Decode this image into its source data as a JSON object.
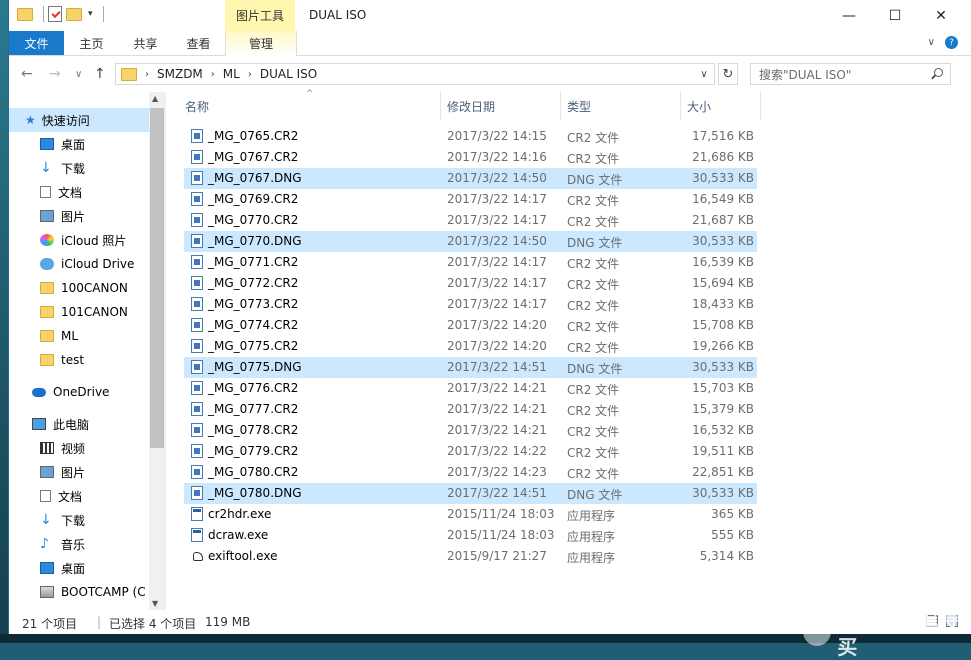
{
  "window": {
    "title": "DUAL ISO",
    "context_tab_header": "图片工具",
    "minimize": "—",
    "maximize": "☐",
    "close": "✕"
  },
  "ribbon": {
    "tabs": [
      "文件",
      "主页",
      "共享",
      "查看",
      "管理"
    ],
    "file_color": "#1979ca"
  },
  "address": {
    "crumbs": [
      "SMZDM",
      "ML",
      "DUAL ISO"
    ],
    "search_placeholder": "搜索\"DUAL ISO\""
  },
  "nav": {
    "quick_access": "快速访问",
    "items": [
      "桌面",
      "下载",
      "文档",
      "图片",
      "iCloud 照片",
      "iCloud Drive",
      "100CANON",
      "101CANON",
      "ML",
      "test"
    ],
    "onedrive": "OneDrive",
    "this_pc": "此电脑",
    "pc_items": [
      "视频",
      "图片",
      "文档",
      "下载",
      "音乐",
      "桌面",
      "BOOTCAMP (C"
    ]
  },
  "columns": {
    "name": "名称",
    "date": "修改日期",
    "type": "类型",
    "size": "大小"
  },
  "files": [
    {
      "name": "_MG_0765.CR2",
      "date": "2017/3/22 14:15",
      "type": "CR2 文件",
      "size": "17,516 KB",
      "selected": false,
      "icon": "image-file-icon"
    },
    {
      "name": "_MG_0767.CR2",
      "date": "2017/3/22 14:16",
      "type": "CR2 文件",
      "size": "21,686 KB",
      "selected": false,
      "icon": "image-file-icon"
    },
    {
      "name": "_MG_0767.DNG",
      "date": "2017/3/22 14:50",
      "type": "DNG 文件",
      "size": "30,533 KB",
      "selected": true,
      "icon": "image-file-icon"
    },
    {
      "name": "_MG_0769.CR2",
      "date": "2017/3/22 14:17",
      "type": "CR2 文件",
      "size": "16,549 KB",
      "selected": false,
      "icon": "image-file-icon"
    },
    {
      "name": "_MG_0770.CR2",
      "date": "2017/3/22 14:17",
      "type": "CR2 文件",
      "size": "21,687 KB",
      "selected": false,
      "icon": "image-file-icon"
    },
    {
      "name": "_MG_0770.DNG",
      "date": "2017/3/22 14:50",
      "type": "DNG 文件",
      "size": "30,533 KB",
      "selected": true,
      "icon": "image-file-icon"
    },
    {
      "name": "_MG_0771.CR2",
      "date": "2017/3/22 14:17",
      "type": "CR2 文件",
      "size": "16,539 KB",
      "selected": false,
      "icon": "image-file-icon"
    },
    {
      "name": "_MG_0772.CR2",
      "date": "2017/3/22 14:17",
      "type": "CR2 文件",
      "size": "15,694 KB",
      "selected": false,
      "icon": "image-file-icon"
    },
    {
      "name": "_MG_0773.CR2",
      "date": "2017/3/22 14:17",
      "type": "CR2 文件",
      "size": "18,433 KB",
      "selected": false,
      "icon": "image-file-icon"
    },
    {
      "name": "_MG_0774.CR2",
      "date": "2017/3/22 14:20",
      "type": "CR2 文件",
      "size": "15,708 KB",
      "selected": false,
      "icon": "image-file-icon"
    },
    {
      "name": "_MG_0775.CR2",
      "date": "2017/3/22 14:20",
      "type": "CR2 文件",
      "size": "19,266 KB",
      "selected": false,
      "icon": "image-file-icon"
    },
    {
      "name": "_MG_0775.DNG",
      "date": "2017/3/22 14:51",
      "type": "DNG 文件",
      "size": "30,533 KB",
      "selected": true,
      "icon": "image-file-icon"
    },
    {
      "name": "_MG_0776.CR2",
      "date": "2017/3/22 14:21",
      "type": "CR2 文件",
      "size": "15,703 KB",
      "selected": false,
      "icon": "image-file-icon"
    },
    {
      "name": "_MG_0777.CR2",
      "date": "2017/3/22 14:21",
      "type": "CR2 文件",
      "size": "15,379 KB",
      "selected": false,
      "icon": "image-file-icon"
    },
    {
      "name": "_MG_0778.CR2",
      "date": "2017/3/22 14:21",
      "type": "CR2 文件",
      "size": "16,532 KB",
      "selected": false,
      "icon": "image-file-icon"
    },
    {
      "name": "_MG_0779.CR2",
      "date": "2017/3/22 14:22",
      "type": "CR2 文件",
      "size": "19,511 KB",
      "selected": false,
      "icon": "image-file-icon"
    },
    {
      "name": "_MG_0780.CR2",
      "date": "2017/3/22 14:23",
      "type": "CR2 文件",
      "size": "22,851 KB",
      "selected": false,
      "icon": "image-file-icon"
    },
    {
      "name": "_MG_0780.DNG",
      "date": "2017/3/22 14:51",
      "type": "DNG 文件",
      "size": "30,533 KB",
      "selected": true,
      "icon": "image-file-icon"
    },
    {
      "name": "cr2hdr.exe",
      "date": "2015/11/24 18:03",
      "type": "应用程序",
      "size": "365 KB",
      "selected": false,
      "icon": "exe-icon"
    },
    {
      "name": "dcraw.exe",
      "date": "2015/11/24 18:03",
      "type": "应用程序",
      "size": "555 KB",
      "selected": false,
      "icon": "exe-icon"
    },
    {
      "name": "exiftool.exe",
      "date": "2015/9/17 21:27",
      "type": "应用程序",
      "size": "5,314 KB",
      "selected": false,
      "icon": "camel-icon"
    }
  ],
  "status": {
    "count": "21 个项目",
    "selection": "已选择 4 个项目",
    "size": "119 MB"
  },
  "colors": {
    "selection": "#cce8ff",
    "accent": "#1979ca",
    "context_tab": "#fff6b0"
  },
  "watermark": "值 | 什么值得买"
}
